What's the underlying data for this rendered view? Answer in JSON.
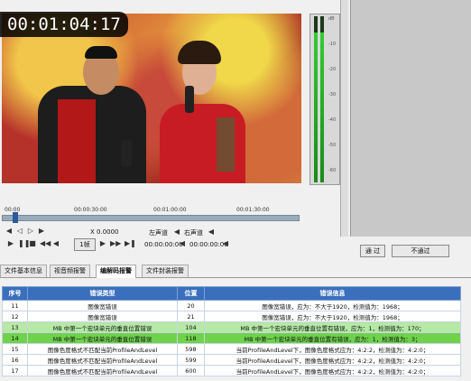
{
  "player": {
    "timecode": "00:01:04:17",
    "timeline_ticks": [
      "00:00",
      "00:00:30:00",
      "00:01:00:00",
      "00:01:30:00"
    ],
    "speed": "X 0.0000",
    "left_channel": "左声道",
    "right_channel": "右声道",
    "current_time": "00:00:00:00",
    "end_time": "00:00:00:00",
    "frame_select": "1帧"
  },
  "meter": {
    "labels": [
      "dB",
      "-10",
      "-20",
      "-30",
      "-40",
      "-50",
      "-60"
    ],
    "left_level": 0.9,
    "right_level": 0.9
  },
  "actions": {
    "pass_label": "通 过",
    "fail_label": "不通过"
  },
  "tabs": [
    {
      "label": "文件基本信息",
      "active": false
    },
    {
      "label": "视音频报警",
      "active": false
    },
    {
      "label": "编解码报警",
      "active": true
    },
    {
      "label": "文件封装报警",
      "active": false
    }
  ],
  "table": {
    "headers": [
      "序号",
      "错误类型",
      "位置",
      "错误信息"
    ],
    "rows": [
      {
        "no": "11",
        "type": "图像宽错误",
        "pos": "20",
        "info": "图像宽错误，应为：不大于1920，检测值为：1968；",
        "hl": ""
      },
      {
        "no": "12",
        "type": "图像宽错误",
        "pos": "21",
        "info": "图像宽错误，应为：不大于1920，检测值为：1968；",
        "hl": ""
      },
      {
        "no": "13",
        "type": "MB 中第一个宏块单元的垂直位置错误",
        "pos": "104",
        "info": "MB 中第一个宏块单元的垂直位置有错误，应为：1，检测值为：170；",
        "hl": "g"
      },
      {
        "no": "14",
        "type": "MB 中第一个宏块单元的垂直位置错误",
        "pos": "118",
        "info": "MB 中第一个宏块单元的垂直位置有错误，应为：1，检测值为：3；",
        "hl": "dg"
      },
      {
        "no": "15",
        "type": "图像色度格式不匹配当前ProfileAndLevel",
        "pos": "598",
        "info": "当前ProfileAndLevel下，图像色度格式应为：4:2:2，检测值为：4:2:0；",
        "hl": ""
      },
      {
        "no": "16",
        "type": "图像色度格式不匹配当前ProfileAndLevel",
        "pos": "599",
        "info": "当前ProfileAndLevel下，图像色度格式应为：4:2:2，检测值为：4:2:0；",
        "hl": ""
      },
      {
        "no": "17",
        "type": "图像色度格式不匹配当前ProfileAndLevel",
        "pos": "600",
        "info": "当前ProfileAndLevel下，图像色度格式应为：4:2:2，检测值为：4:2:0；",
        "hl": ""
      }
    ]
  }
}
